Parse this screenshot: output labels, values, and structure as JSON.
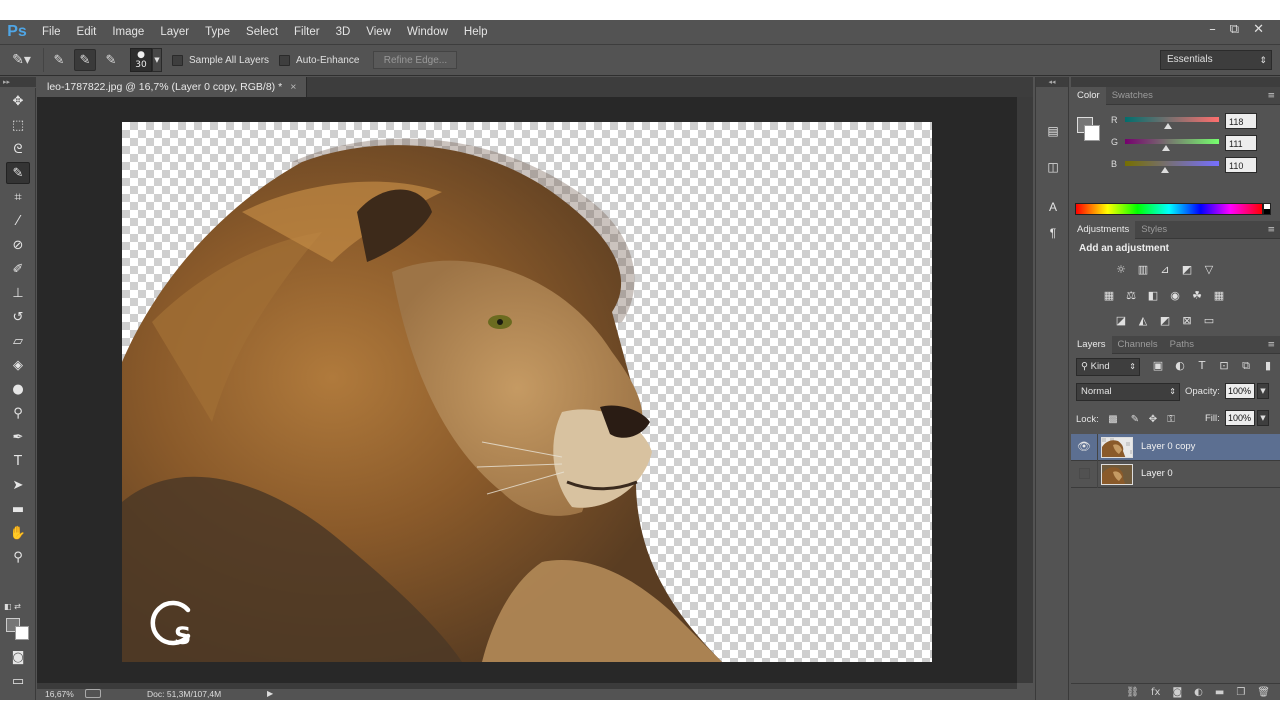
{
  "app": {
    "logo": "Ps"
  },
  "menu": [
    "File",
    "Edit",
    "Image",
    "Layer",
    "Type",
    "Select",
    "Filter",
    "3D",
    "View",
    "Window",
    "Help"
  ],
  "window_controls": [
    "–",
    "⧉",
    "✕"
  ],
  "options": {
    "brush_size": "30",
    "sample_all_layers": "Sample All Layers",
    "auto_enhance": "Auto-Enhance",
    "refine_edge": "Refine Edge...",
    "workspace": "Essentials"
  },
  "document": {
    "tab_title": "leo-1787822.jpg @ 16,7% (Layer 0 copy, RGB/8) *",
    "tab_close": "×",
    "watermark": "CS"
  },
  "status": {
    "zoom": "16,67%",
    "doc_info": "Doc: 51,3M/107,4M"
  },
  "color_panel": {
    "tabs": [
      "Color",
      "Swatches"
    ],
    "channels": [
      {
        "label": "R",
        "value": "118",
        "fraction": 0.46
      },
      {
        "label": "G",
        "value": "111",
        "fraction": 0.44
      },
      {
        "label": "B",
        "value": "110",
        "fraction": 0.43
      }
    ],
    "foreground": "#767676",
    "background": "#ffffff"
  },
  "adjustments_panel": {
    "tabs": [
      "Adjustments",
      "Styles"
    ],
    "title": "Add an adjustment"
  },
  "layers_panel": {
    "tabs": [
      "Layers",
      "Channels",
      "Paths"
    ],
    "kind_filter": "Kind",
    "blend_mode": "Normal",
    "opacity_label": "Opacity:",
    "opacity": "100%",
    "lock_label": "Lock:",
    "fill_label": "Fill:",
    "fill": "100%",
    "layers": [
      {
        "name": "Layer 0 copy",
        "visible": true,
        "selected": true
      },
      {
        "name": "Layer 0",
        "visible": false,
        "selected": false
      }
    ]
  },
  "colors": {
    "accent": "#4fa6e6",
    "selected_layer": "#5c6f91",
    "ui_bg": "#535353"
  }
}
